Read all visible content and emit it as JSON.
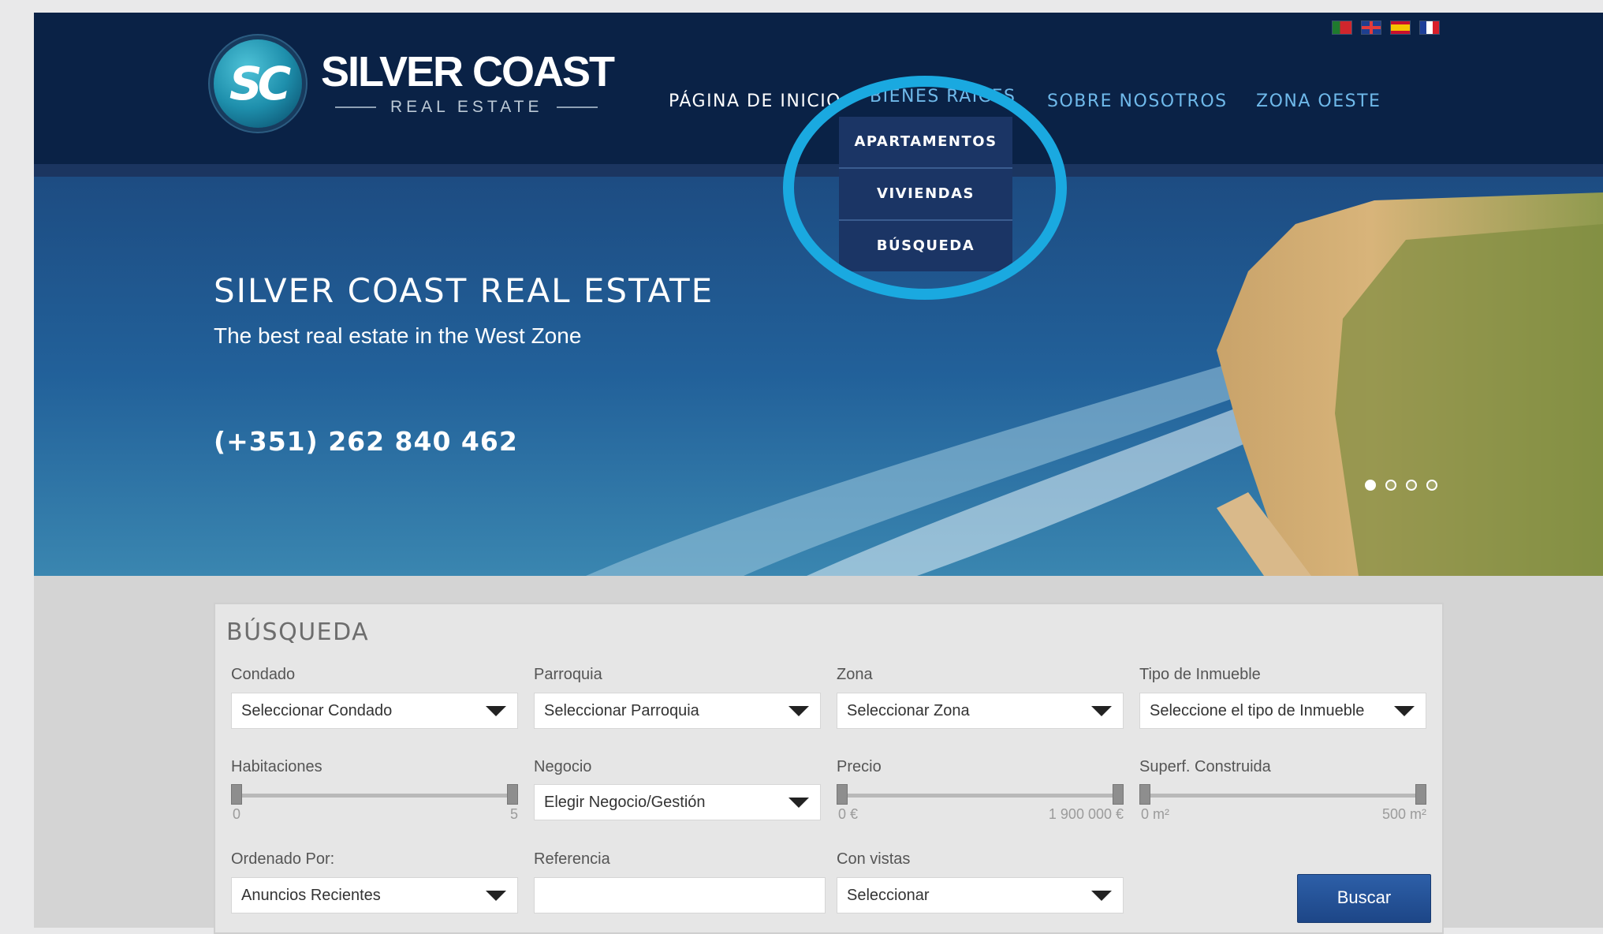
{
  "brand": {
    "logo_letters": "SC",
    "name": "SILVER COAST",
    "subtitle": "REAL ESTATE"
  },
  "languages": [
    {
      "code": "pt",
      "icon": "flag-portugal-icon"
    },
    {
      "code": "en",
      "icon": "flag-uk-icon"
    },
    {
      "code": "es",
      "icon": "flag-spain-icon"
    },
    {
      "code": "fr",
      "icon": "flag-france-icon"
    }
  ],
  "nav": {
    "items": [
      {
        "label": "PÁGINA DE INICIO"
      },
      {
        "label": "BIENES RAÍCES"
      },
      {
        "label": "SOBRE NOSOTROS"
      },
      {
        "label": "ZONA OESTE"
      }
    ],
    "dropdown": [
      "APARTAMENTOS",
      "VIVIENDAS",
      "BÚSQUEDA"
    ],
    "highlight_color": "#1aa9e0"
  },
  "hero": {
    "title": "SILVER COAST REAL ESTATE",
    "subtitle": "The best real estate in the West Zone",
    "phone": "(+351) 262 840 462",
    "slides_active_index": 0
  },
  "search": {
    "title": "BÚSQUEDA",
    "condado": {
      "label": "Condado",
      "value": "Seleccionar Condado"
    },
    "parroquia": {
      "label": "Parroquia",
      "value": "Seleccionar Parroquia"
    },
    "zona": {
      "label": "Zona",
      "value": "Seleccionar Zona"
    },
    "tipo": {
      "label": "Tipo de Inmueble",
      "value": "Seleccione el tipo de Inmueble"
    },
    "habitaciones": {
      "label": "Habitaciones",
      "min": "0",
      "max": "5"
    },
    "negocio": {
      "label": "Negocio",
      "value": "Elegir Negocio/Gestión"
    },
    "precio": {
      "label": "Precio",
      "min": "0 €",
      "max": "1 900 000 €"
    },
    "superficie": {
      "label": "Superf. Construida",
      "min": "0 m²",
      "max": "500 m²"
    },
    "ordenado": {
      "label": "Ordenado Por:",
      "value": "Anuncios Recientes"
    },
    "referencia": {
      "label": "Referencia",
      "value": ""
    },
    "vistas": {
      "label": "Con vistas",
      "value": "Seleccionar"
    },
    "submit_label": "Buscar"
  },
  "colors": {
    "header_bg": "#0a2246",
    "nav_accent": "#6fb9ea",
    "button_blue": "#1d4687"
  }
}
